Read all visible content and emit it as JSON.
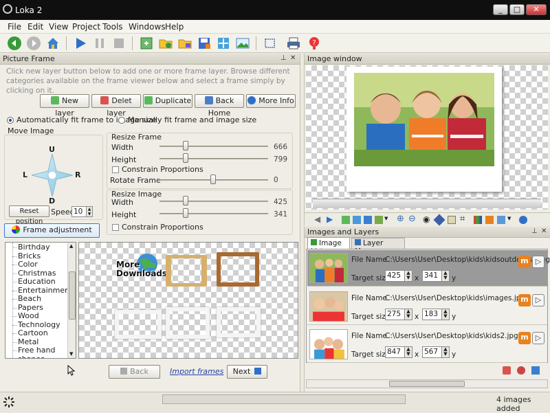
{
  "window": {
    "title": "Loka 2",
    "controls": [
      "_",
      "□",
      "✕"
    ]
  },
  "menu": {
    "items": [
      "File",
      "Edit",
      "View",
      "Project",
      "Tools",
      "Windows",
      "Help"
    ]
  },
  "picture_frame": {
    "title": "Picture Frame",
    "hint": "Click new layer button below to add one or more frame layer. Browse different categories available on the frame viewer below and select a frame simply by clicking on it.",
    "buttons": {
      "new_layer": "New layer",
      "delete_layer": "Delet layer",
      "duplicate": "Duplicate",
      "back_home": "Back Home",
      "more_info": "More Info"
    },
    "fit_options": {
      "auto": "Automatically fit frame to image size",
      "manual": "Manually fit frame and image size",
      "selected": "auto"
    },
    "move_image": {
      "title": "Move Image",
      "up": "U",
      "down": "D",
      "left": "L",
      "right": "R",
      "reset": "Reset position",
      "speed_label": "Speed:",
      "speed_value": "10"
    },
    "resize_frame": {
      "title": "Resize Frame",
      "width_label": "Width",
      "width_value": "666",
      "height_label": "Height",
      "height_value": "799",
      "constrain": "Constrain Proportions",
      "rotate_label": "Rotate Frame",
      "rotate_value": "0"
    },
    "resize_image": {
      "title": "Resize Image",
      "width_label": "Width",
      "width_value": "425",
      "height_label": "Height",
      "height_value": "341",
      "constrain": "Constrain Proportions"
    },
    "frame_adjustment": "Frame adjustment",
    "categories": [
      "Birthday",
      "Bricks",
      "Color",
      "Christmas",
      "Education",
      "Entertainments",
      "Beach",
      "Papers",
      "Wood",
      "Technology",
      "Cartoon",
      "Metal",
      "Free hand",
      "shapes"
    ],
    "more_downloads": "More Downloads",
    "nav": {
      "back": "Back",
      "import": "Import frames",
      "next": "Next"
    }
  },
  "image_window": {
    "title": "Image window"
  },
  "images_layers": {
    "title": "Images and Layers",
    "tabs": [
      "Image List",
      "Layer Manager"
    ],
    "file_label": "File Name",
    "size_label": "Target size",
    "x": "x",
    "y": "y",
    "rows": [
      {
        "path": "C:\\Users\\User\\Desktop\\kids\\kidsoutdoors.jpeg",
        "w": "425",
        "h": "341",
        "selected": true
      },
      {
        "path": "C:\\Users\\User\\Desktop\\kids\\images.jpg",
        "w": "275",
        "h": "183",
        "selected": false
      },
      {
        "path": "C:\\Users\\User\\Desktop\\kids\\kids2.jpg",
        "w": "847",
        "h": "567",
        "selected": false
      }
    ],
    "row_buttons": [
      "m",
      "▷"
    ]
  },
  "status": {
    "text": "4 images added"
  },
  "colors": {
    "title_bar": "#0f0f0f",
    "panel_header": "#d3d0c4",
    "selected_row": "#9a9a9a",
    "accent_blue": "#2f6fc9",
    "orange": "#e8821e"
  }
}
